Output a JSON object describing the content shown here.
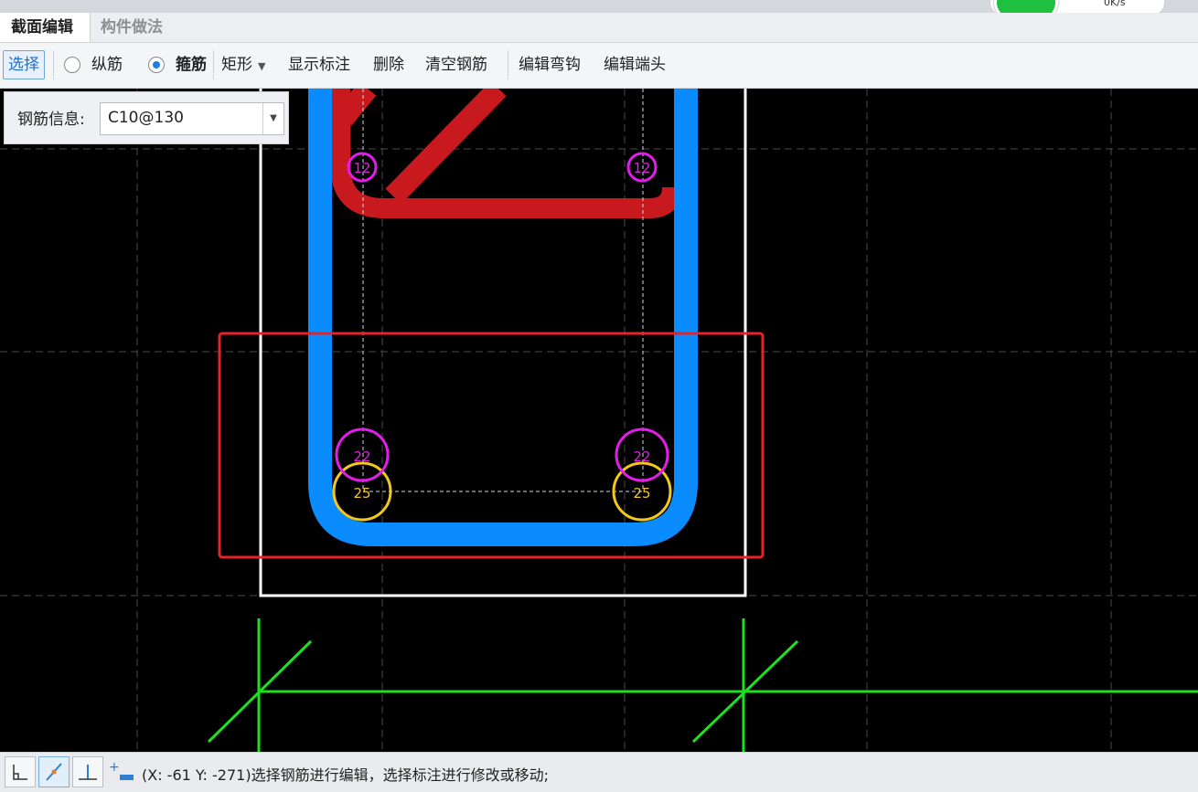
{
  "tabs": [
    {
      "label": "截面编辑",
      "active": true
    },
    {
      "label": "构件做法",
      "active": false
    }
  ],
  "speed_badge": {
    "text": "0K/s"
  },
  "toolbar": {
    "select_label": "选择",
    "radio_longitudinal": "纵筋",
    "radio_stirrup": "箍筋",
    "rect_label": "矩形",
    "show_annotation": "显示标注",
    "delete": "删除",
    "clear_rebar": "清空钢筋",
    "edit_hook": "编辑弯钩",
    "edit_end": "编辑端头"
  },
  "rebar_info": {
    "label": "钢筋信息:",
    "value": "C10@130"
  },
  "canvas": {
    "bar_labels": {
      "top_left": "12",
      "top_right": "12",
      "bottom_left_magenta": "22",
      "bottom_right_magenta": "22",
      "bottom_left_yellow": "25",
      "bottom_right_yellow": "25"
    },
    "colors": {
      "stirrup": "#0a8cff",
      "tie": "#c8191f",
      "magenta": "#e31de8",
      "yellow": "#f2c81b",
      "axis": "#1fe01f",
      "highlight": "#e8222a",
      "outline": "#ffffff"
    }
  },
  "status": {
    "text": "(X: -61 Y: -271)选择钢筋进行编辑，选择标注进行修改或移动;"
  }
}
